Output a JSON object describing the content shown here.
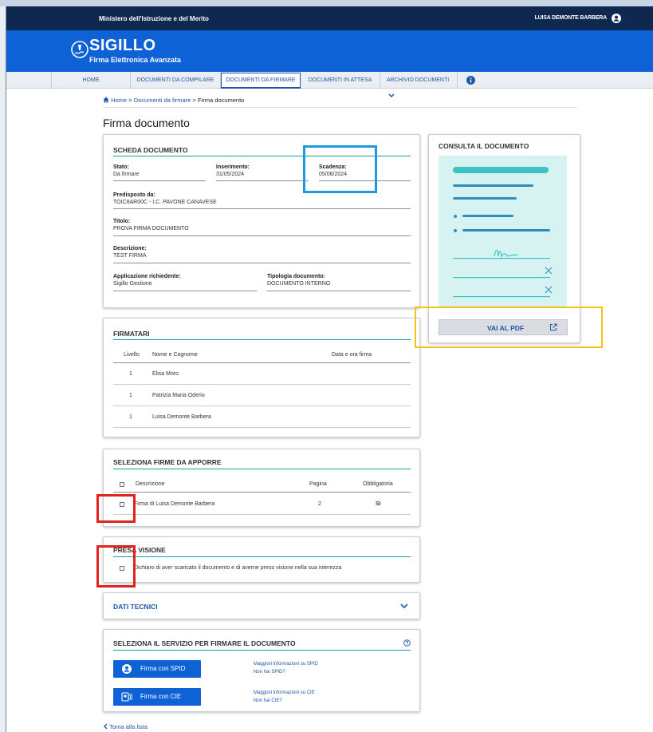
{
  "header": {
    "ministry": "Ministero dell'Istruzione e del Merito",
    "user_name": "LUISA DEMONTE BARBERA",
    "brand_title": "SIGILLO",
    "brand_subtitle": "Firma Elettronica Avanzata"
  },
  "nav": {
    "items": [
      {
        "label": "HOME"
      },
      {
        "label": "DOCUMENTI DA COMPILARE"
      },
      {
        "label": "DOCUMENTI DA FIRMARE"
      },
      {
        "label": "DOCUMENTI IN ATTESA"
      },
      {
        "label": "ARCHIVIO DOCUMENTI"
      }
    ]
  },
  "breadcrumb": {
    "home": "Home",
    "sep1": ">",
    "level1": "Documenti da firmare",
    "sep2": ">",
    "current": "Firma documento"
  },
  "page_title": "Firma documento",
  "scheda": {
    "title": "SCHEDA DOCUMENTO",
    "stato_label": "Stato:",
    "stato_value": "Da firmare",
    "inserimento_label": "Inserimento:",
    "inserimento_value": "31/05/2024",
    "scadenza_label": "Scadenza:",
    "scadenza_value": "05/06/2024",
    "predisposto_label": "Predisposto da:",
    "predisposto_value": "TOIC8AR00C - I.C. PAVONE CANAVESE",
    "titolo_label": "Titolo:",
    "titolo_value": "PROVA FIRMA DOCUMENTO",
    "descrizione_label": "Descrizione:",
    "descrizione_value": "TEST FIRMA",
    "applicazione_label": "Applicazione richiedente:",
    "applicazione_value": "Sigillo Gestione",
    "tipologia_label": "Tipologia documento:",
    "tipologia_value": "DOCUMENTO INTERNO"
  },
  "consulta": {
    "title": "CONSULTA IL DOCUMENTO",
    "button_label": "VAI AL PDF"
  },
  "firmatari": {
    "title": "FIRMATARI",
    "headers": [
      "Livello",
      "Nome e Cognome",
      "Data e ora firma"
    ],
    "rows": [
      {
        "livello": "1",
        "nome": "Elisa Moro"
      },
      {
        "livello": "1",
        "nome": "Patrizia Maria Oderio"
      },
      {
        "livello": "1",
        "nome": "Luisa Demonte Barbera"
      }
    ]
  },
  "firme": {
    "title": "SELEZIONA FIRME DA APPORRE",
    "headers": [
      "Descrizione",
      "Pagina",
      "Obbligatoria"
    ],
    "row": {
      "descrizione": "Firma di Luisa Demonte Barbera",
      "pagina": "2",
      "obbligatoria": "Sì"
    }
  },
  "presa_visione": {
    "title": "PRESA VISIONE",
    "text": "Dichiaro di aver scaricato il documento e di averne preso visione nella sua interezza"
  },
  "dati_tecnici": {
    "title": "DATI TECNICI"
  },
  "servizio": {
    "title": "SELEZIONA IL SERVIZIO PER FIRMARE IL DOCUMENTO",
    "spid_label": "Firma con SPID",
    "spid_info": "Maggiori informazioni su SPID",
    "spid_none": "Non hai SPID?",
    "cie_label": "Firma con CIE",
    "cie_info": "Maggiori informazioni su CIE",
    "cie_none": "Non hai CIE?"
  },
  "back_link": "Torna alla lista",
  "colors": {
    "brand_blue": "#0f62d6",
    "navy": "#0e2850",
    "teal_rule": "#17a0a8",
    "highlight_blue": "#1a9be0",
    "highlight_yellow": "#f5c21a",
    "highlight_red": "#e0231f"
  }
}
